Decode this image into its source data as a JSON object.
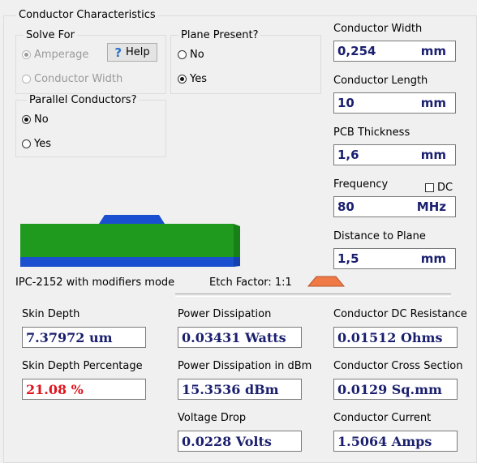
{
  "section_title": "Conductor Characteristics",
  "solve_for": {
    "legend": "Solve For",
    "options": [
      {
        "label": "Amperage",
        "selected": true,
        "disabled": true
      },
      {
        "label": "Conductor Width",
        "selected": false,
        "disabled": true
      }
    ],
    "help_label": "Help"
  },
  "plane_present": {
    "legend": "Plane Present?",
    "options": [
      {
        "label": "No",
        "selected": false
      },
      {
        "label": "Yes",
        "selected": true
      }
    ]
  },
  "parallel_conductors": {
    "legend": "Parallel Conductors?",
    "options": [
      {
        "label": "No",
        "selected": true
      },
      {
        "label": "Yes",
        "selected": false
      }
    ]
  },
  "inputs": {
    "width": {
      "label": "Conductor Width",
      "value": "0,254",
      "unit": "mm"
    },
    "length": {
      "label": "Conductor Length",
      "value": "10",
      "unit": "mm"
    },
    "thickness": {
      "label": "PCB Thickness",
      "value": "1,6",
      "unit": "mm"
    },
    "frequency": {
      "label": "Frequency",
      "value": "80",
      "unit": "MHz",
      "dc_label": "DC",
      "dc_checked": false
    },
    "distance": {
      "label": "Distance to Plane",
      "value": "1,5",
      "unit": "mm"
    }
  },
  "mode_text": "IPC-2152 with modifiers mode",
  "etch_factor": "Etch Factor: 1:1",
  "results": {
    "skin_depth": {
      "label": "Skin Depth",
      "value": "7.37972 um"
    },
    "skin_depth_pct": {
      "label": "Skin Depth Percentage",
      "value": "21.08 %"
    },
    "power": {
      "label": "Power Dissipation",
      "value": "0.03431 Watts"
    },
    "power_dbm": {
      "label": "Power Dissipation in dBm",
      "value": "15.3536 dBm"
    },
    "voltage_drop": {
      "label": "Voltage Drop",
      "value": "0.0228 Volts"
    },
    "dc_resistance": {
      "label": "Conductor DC Resistance",
      "value": "0.01512 Ohms"
    },
    "cross_section": {
      "label": "Conductor Cross Section",
      "value": "0.0129 Sq.mm"
    },
    "current": {
      "label": "Conductor Current",
      "value": "1.5064 Amps"
    }
  },
  "colors": {
    "value_text": "#1a1f6e",
    "warning_text": "#e0141e",
    "pcb_green": "#1f9a1f",
    "copper_blue": "#1a4fd0",
    "etch_orange": "#f07a45"
  }
}
